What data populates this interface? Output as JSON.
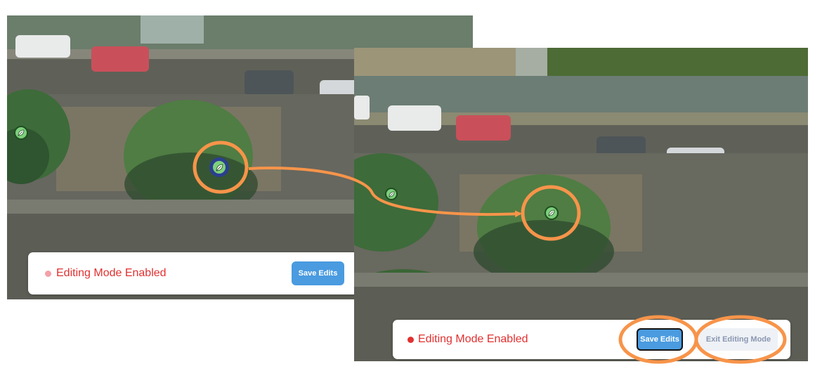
{
  "before": {
    "status_text": "Editing Mode Enabled",
    "save_label": "Save Edits"
  },
  "after": {
    "status_text": "Editing Mode Enabled",
    "save_label": "Save Edits",
    "exit_label": "Exit Editing Mode"
  },
  "colors": {
    "accent_orange": "#f7944a",
    "status_red": "#e23030",
    "status_dot_faded": "#f4a0a8",
    "save_blue": "#4a9be0",
    "marker_green": "#7ed07e",
    "marker_selected_ring": "#2b3f8f",
    "exit_text": "#8a97b0"
  },
  "icons": {
    "tree_marker": "leaf-icon"
  }
}
